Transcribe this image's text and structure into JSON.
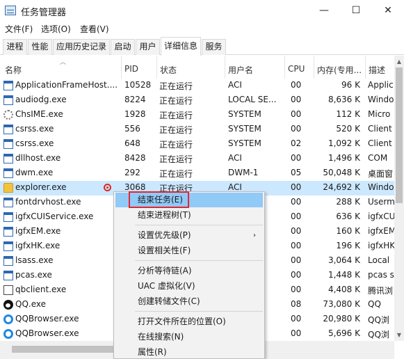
{
  "window": {
    "title": "任务管理器",
    "min": "—",
    "max": "☐",
    "close": "✕"
  },
  "menu": [
    "文件(F)",
    "选项(O)",
    "查看(V)"
  ],
  "tabs": [
    "进程",
    "性能",
    "应用历史记录",
    "启动",
    "用户",
    "详细信息",
    "服务"
  ],
  "active_tab": "详细信息",
  "columns": [
    "名称",
    "PID",
    "状态",
    "用户名",
    "CPU",
    "内存(专用...",
    "描述"
  ],
  "rows": [
    {
      "icon": "window-icon",
      "name": "ApplicationFrameHost....",
      "pid": "10528",
      "status": "正在运行",
      "user": "ACI",
      "cpu": "00",
      "mem": "96 K",
      "desc": "Applic"
    },
    {
      "icon": "window-icon",
      "name": "audiodg.exe",
      "pid": "8224",
      "status": "正在运行",
      "user": "LOCAL SE...",
      "cpu": "00",
      "mem": "8,636 K",
      "desc": "Windo"
    },
    {
      "icon": "gear-icon",
      "name": "ChsIME.exe",
      "pid": "1928",
      "status": "正在运行",
      "user": "SYSTEM",
      "cpu": "00",
      "mem": "112 K",
      "desc": "Micro"
    },
    {
      "icon": "window-icon",
      "name": "csrss.exe",
      "pid": "556",
      "status": "正在运行",
      "user": "SYSTEM",
      "cpu": "00",
      "mem": "520 K",
      "desc": "Client"
    },
    {
      "icon": "window-icon",
      "name": "csrss.exe",
      "pid": "648",
      "status": "正在运行",
      "user": "SYSTEM",
      "cpu": "02",
      "mem": "1,092 K",
      "desc": "Client"
    },
    {
      "icon": "window-icon",
      "name": "dllhost.exe",
      "pid": "8428",
      "status": "正在运行",
      "user": "ACI",
      "cpu": "00",
      "mem": "1,496 K",
      "desc": "COM"
    },
    {
      "icon": "window-icon",
      "name": "dwm.exe",
      "pid": "292",
      "status": "正在运行",
      "user": "DWM-1",
      "cpu": "05",
      "mem": "50,048 K",
      "desc": "桌面窗"
    },
    {
      "icon": "folder-icon",
      "name": "explorer.exe",
      "pid": "3068",
      "status": "正在运行",
      "user": "ACI",
      "cpu": "00",
      "mem": "24,692 K",
      "desc": "Windo",
      "selected": true
    },
    {
      "icon": "window-icon",
      "name": "fontdrvhost.exe",
      "pid": "",
      "status": "",
      "user": "",
      "cpu": "00",
      "mem": "288 K",
      "desc": "Userm"
    },
    {
      "icon": "window-icon",
      "name": "igfxCUIService.exe",
      "pid": "",
      "status": "",
      "user": "",
      "cpu": "00",
      "mem": "636 K",
      "desc": "igfxCU"
    },
    {
      "icon": "window-icon",
      "name": "igfxEM.exe",
      "pid": "",
      "status": "",
      "user": "",
      "cpu": "00",
      "mem": "160 K",
      "desc": "igfxEM"
    },
    {
      "icon": "window-icon",
      "name": "igfxHK.exe",
      "pid": "",
      "status": "",
      "user": "",
      "cpu": "00",
      "mem": "196 K",
      "desc": "igfxHK"
    },
    {
      "icon": "window-icon",
      "name": "lsass.exe",
      "pid": "",
      "status": "",
      "user": "",
      "cpu": "00",
      "mem": "3,064 K",
      "desc": "Local"
    },
    {
      "icon": "window-icon",
      "name": "pcas.exe",
      "pid": "",
      "status": "",
      "user": "",
      "cpu": "00",
      "mem": "1,448 K",
      "desc": "pcas s"
    },
    {
      "icon": "blank-icon",
      "name": "qbclient.exe",
      "pid": "",
      "status": "",
      "user": "",
      "cpu": "00",
      "mem": "4,408 K",
      "desc": "腾讯浏"
    },
    {
      "icon": "qq-icon",
      "name": "QQ.exe",
      "pid": "",
      "status": "",
      "user": "",
      "cpu": "08",
      "mem": "73,080 K",
      "desc": "QQ"
    },
    {
      "icon": "qqbrowser-icon",
      "name": "QQBrowser.exe",
      "pid": "",
      "status": "",
      "user": "",
      "cpu": "00",
      "mem": "20,980 K",
      "desc": "QQ浏"
    },
    {
      "icon": "qqbrowser-icon",
      "name": "QQBrowser.exe",
      "pid": "",
      "status": "",
      "user": "",
      "cpu": "00",
      "mem": "5,696 K",
      "desc": "QQ浏"
    }
  ],
  "context_menu": {
    "items": [
      "结束任务(E)",
      "结束进程树(T)",
      "设置优先级(P)",
      "设置相关性(F)",
      "分析等待链(A)",
      "UAC 虚拟化(V)",
      "创建转储文件(C)",
      "打开文件所在的位置(O)",
      "在线搜索(N)",
      "属性(R)"
    ],
    "submenu_arrow": "›"
  },
  "scroll": {
    "up": "▲",
    "down": "▼"
  },
  "accent_colors": {
    "selection": "#cce8ff",
    "menu_hover": "#91c9f7",
    "highlight_box": "#e3272d"
  }
}
